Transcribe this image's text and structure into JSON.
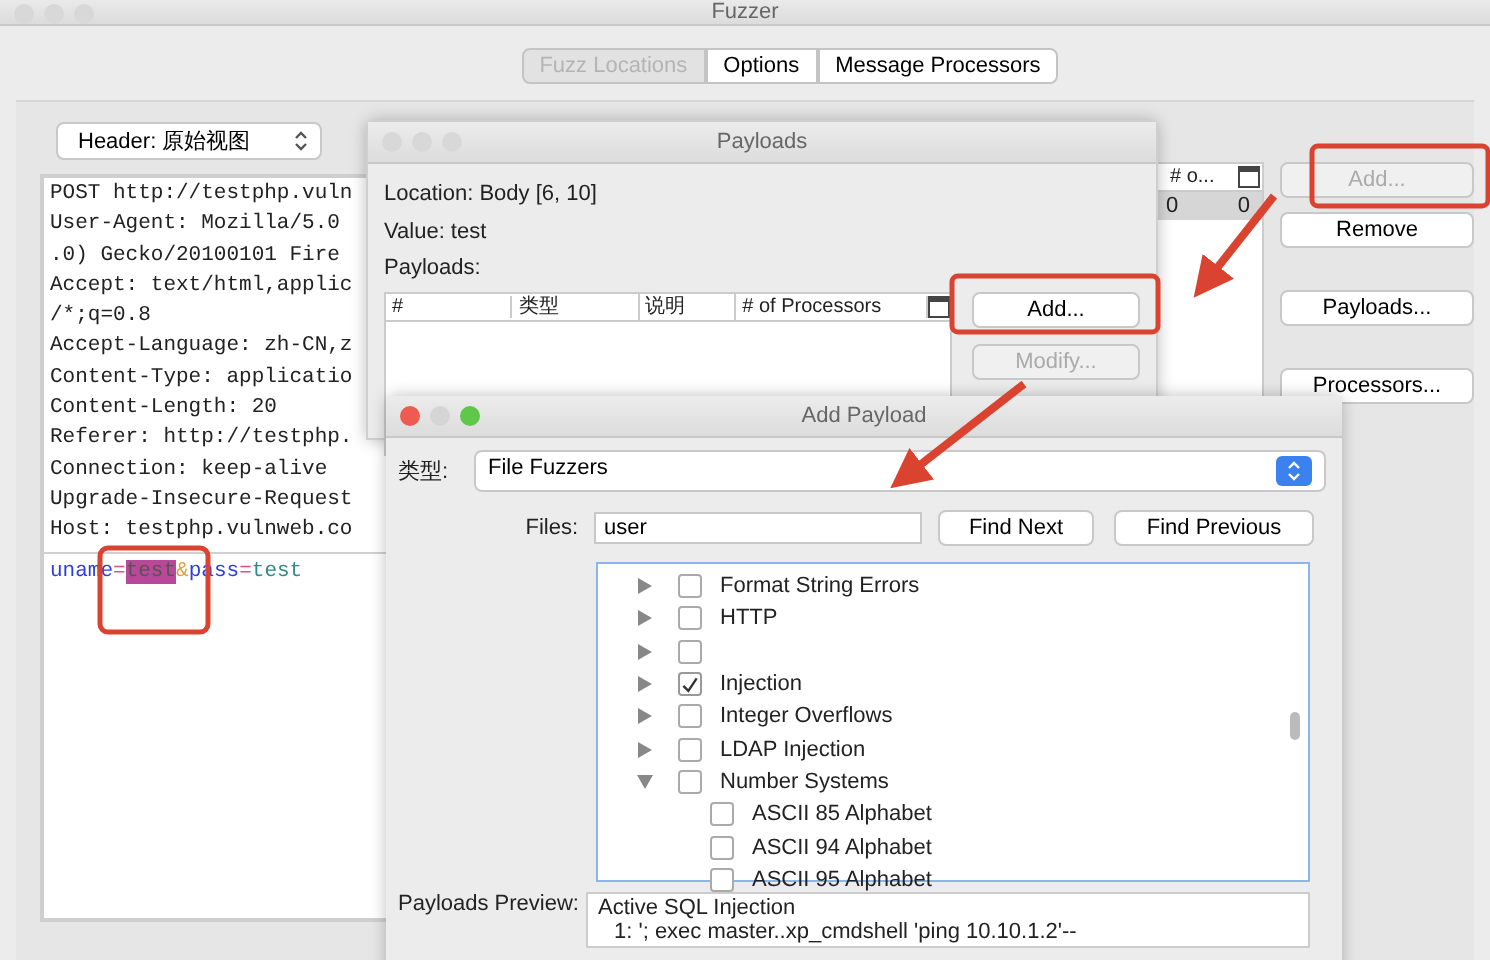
{
  "fuzzer": {
    "title": "Fuzzer",
    "active": false,
    "tabs": [
      {
        "label": "Fuzz Locations",
        "selected": true
      },
      {
        "label": "Options",
        "selected": false
      },
      {
        "label": "Message Processors",
        "selected": false
      }
    ],
    "view_select": "Header: 原始视图",
    "request_lines": [
      "POST http://testphp.vuln",
      "User-Agent: Mozilla/5.0",
      ".0) Gecko/20100101 Fire",
      "Accept: text/html,applic",
      "/*;q=0.8",
      "Accept-Language: zh-CN,z",
      "Content-Type: applicatio",
      "Content-Length: 20",
      "Referer: http://testphp.",
      "Connection: keep-alive",
      "Upgrade-Insecure-Request",
      "Host: testphp.vulnweb.co"
    ],
    "body": [
      {
        "text": "uname",
        "kind": "key",
        "selected": false
      },
      {
        "text": "=",
        "kind": "sep",
        "selected": false
      },
      {
        "text": "test",
        "kind": "value",
        "selected": true
      },
      {
        "text": "&",
        "kind": "amp",
        "selected": false
      },
      {
        "text": "pass",
        "kind": "key",
        "selected": false
      },
      {
        "text": "=",
        "kind": "sep",
        "selected": false
      },
      {
        "text": "test",
        "kind": "value",
        "selected": false
      }
    ],
    "table": {
      "column": "# o...",
      "cells": [
        "0",
        "0"
      ]
    },
    "buttons": [
      {
        "label": "Add...",
        "disabled": true
      },
      {
        "label": "Remove",
        "disabled": false
      },
      {
        "label": "Payloads...",
        "disabled": false
      },
      {
        "label": "Processors...",
        "disabled": false
      }
    ]
  },
  "payloads_dialog": {
    "title": "Payloads",
    "active": false,
    "location": "Location: Body [6, 10]",
    "value": "Value: test",
    "payloads_label": "Payloads:",
    "columns": [
      "#",
      "类型",
      "说明",
      "# of Processors"
    ],
    "buttons": [
      {
        "label": "Add...",
        "disabled": false
      },
      {
        "label": "Modify...",
        "disabled": true
      }
    ]
  },
  "add_payload_dialog": {
    "title": "Add Payload",
    "active": true,
    "type_label": "类型:",
    "type_select": "File Fuzzers",
    "files_label": "Files:",
    "files_value": "user",
    "find_next": "Find Next",
    "find_previous": "Find Previous",
    "tree": [
      {
        "label": "Format String Errors",
        "checked": false,
        "expanded": false
      },
      {
        "label": "HTTP",
        "checked": false,
        "expanded": false
      },
      {
        "checked": false,
        "expanded": false
      },
      {
        "label": "Injection",
        "checked": true,
        "expanded": false
      },
      {
        "label": "Integer Overflows",
        "checked": false,
        "expanded": false
      },
      {
        "label": "LDAP Injection",
        "checked": false,
        "expanded": false
      },
      {
        "label": "Number Systems",
        "checked": false,
        "expanded": true,
        "children": [
          {
            "label": "ASCII 85 Alphabet",
            "checked": false
          },
          {
            "label": "ASCII 94 Alphabet",
            "checked": false
          },
          {
            "label": "ASCII 95 Alphabet",
            "checked": false
          }
        ]
      }
    ],
    "preview_label": "Payloads Preview:",
    "preview_lines": [
      "Active SQL Injection",
      "1: '; exec master..xp_cmdshell 'ping 10.10.1.2'--"
    ]
  }
}
